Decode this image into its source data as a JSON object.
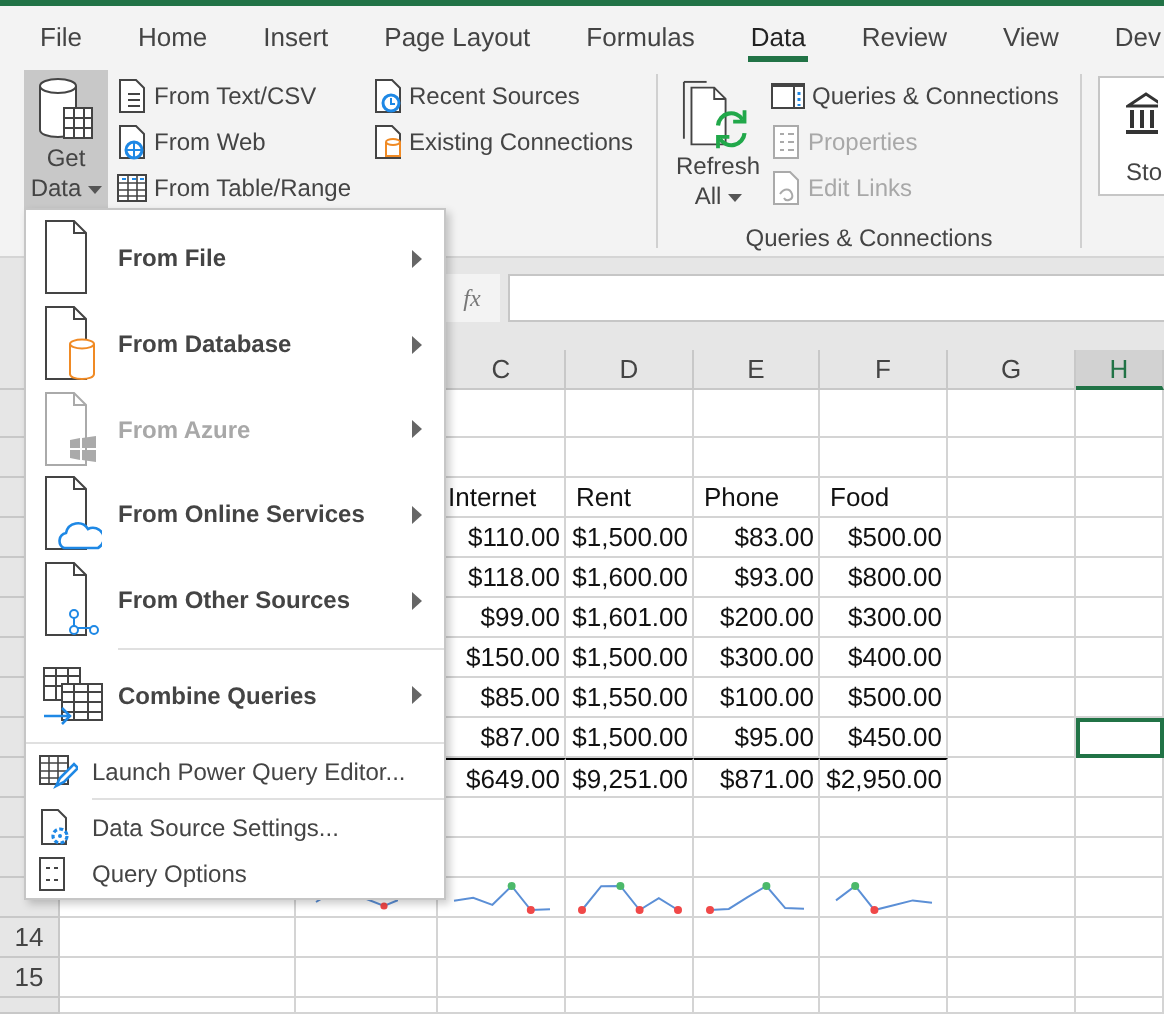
{
  "tabs": [
    {
      "label": "File",
      "selected": false
    },
    {
      "label": "Home",
      "selected": false
    },
    {
      "label": "Insert",
      "selected": false
    },
    {
      "label": "Page Layout",
      "selected": false
    },
    {
      "label": "Formulas",
      "selected": false
    },
    {
      "label": "Data",
      "selected": true
    },
    {
      "label": "Review",
      "selected": false
    },
    {
      "label": "View",
      "selected": false
    },
    {
      "label": "Dev",
      "selected": false
    }
  ],
  "ribbon": {
    "get_data": {
      "label_lines": [
        "Get",
        "Data"
      ],
      "expanded": true
    },
    "get_transform": [
      {
        "label": "From Text/CSV"
      },
      {
        "label": "From Web"
      },
      {
        "label": "From Table/Range"
      },
      {
        "label": "Recent Sources"
      },
      {
        "label": "Existing Connections"
      }
    ],
    "queries_group": {
      "refresh": {
        "label_lines": [
          "Refresh",
          "All"
        ]
      },
      "items": [
        {
          "label": "Queries & Connections",
          "disabled": false
        },
        {
          "label": "Properties",
          "disabled": true
        },
        {
          "label": "Edit Links",
          "disabled": true
        }
      ],
      "group_label": "Queries & Connections"
    },
    "stocks": {
      "label": "Sto"
    }
  },
  "formula_bar": {
    "function_label": "fx"
  },
  "sheet": {
    "columns": [
      {
        "label": "C",
        "selected": false
      },
      {
        "label": "D",
        "selected": false
      },
      {
        "label": "E",
        "selected": false
      },
      {
        "label": "F",
        "selected": false
      },
      {
        "label": "G",
        "selected": false
      },
      {
        "label": "H",
        "selected": true
      }
    ],
    "rows": [
      {
        "kind": "empty"
      },
      {
        "kind": "empty"
      },
      {
        "kind": "header",
        "cells": [
          "Internet",
          "Rent",
          "Phone",
          "Food"
        ]
      },
      {
        "kind": "data",
        "cells": [
          "$110.00",
          "$1,500.00",
          "$83.00",
          "$500.00"
        ],
        "cursor": false
      },
      {
        "kind": "data",
        "cells": [
          "$118.00",
          "$1,600.00",
          "$93.00",
          "$800.00"
        ],
        "cursor": false
      },
      {
        "kind": "data",
        "cells": [
          "$99.00",
          "$1,601.00",
          "$200.00",
          "$300.00"
        ],
        "cursor": false
      },
      {
        "kind": "data",
        "cells": [
          "$150.00",
          "$1,500.00",
          "$300.00",
          "$400.00"
        ],
        "cursor": false
      },
      {
        "kind": "data",
        "cells": [
          "$85.00",
          "$1,550.00",
          "$100.00",
          "$500.00"
        ],
        "cursor": false
      },
      {
        "kind": "data",
        "cells": [
          "$87.00",
          "$1,500.00",
          "$95.00",
          "$450.00"
        ],
        "cursor": true
      },
      {
        "kind": "total",
        "cells": [
          "$649.00",
          "$9,251.00",
          "$871.00",
          "$2,950.00"
        ]
      },
      {
        "kind": "empty"
      },
      {
        "kind": "empty"
      },
      {
        "kind": "sparklines"
      },
      {
        "kind": "empty",
        "number": "14"
      },
      {
        "kind": "empty",
        "number": "15"
      },
      {
        "kind": "empty"
      }
    ]
  },
  "menu": {
    "groups": [
      {
        "items": [
          {
            "label": "From File",
            "kind": "large",
            "submenu": true,
            "disabled": false
          },
          {
            "label": "From Database",
            "kind": "large",
            "submenu": true,
            "disabled": false
          },
          {
            "label": "From Azure",
            "kind": "large",
            "submenu": true,
            "disabled": true
          },
          {
            "label": "From Online Services",
            "kind": "large",
            "submenu": true,
            "disabled": false
          },
          {
            "label": "From Other Sources",
            "kind": "large",
            "submenu": true,
            "disabled": false
          }
        ]
      },
      {
        "items": [
          {
            "label": "Combine Queries",
            "kind": "large",
            "submenu": true,
            "disabled": false
          }
        ]
      },
      {
        "items": [
          {
            "label": "Launch Power Query Editor...",
            "kind": "small",
            "submenu": false,
            "disabled": false
          }
        ]
      },
      {
        "items": [
          {
            "label": "Data Source Settings...",
            "kind": "small",
            "submenu": false,
            "disabled": false
          },
          {
            "label": "Query Options",
            "kind": "small",
            "submenu": false,
            "disabled": false
          }
        ]
      }
    ]
  }
}
